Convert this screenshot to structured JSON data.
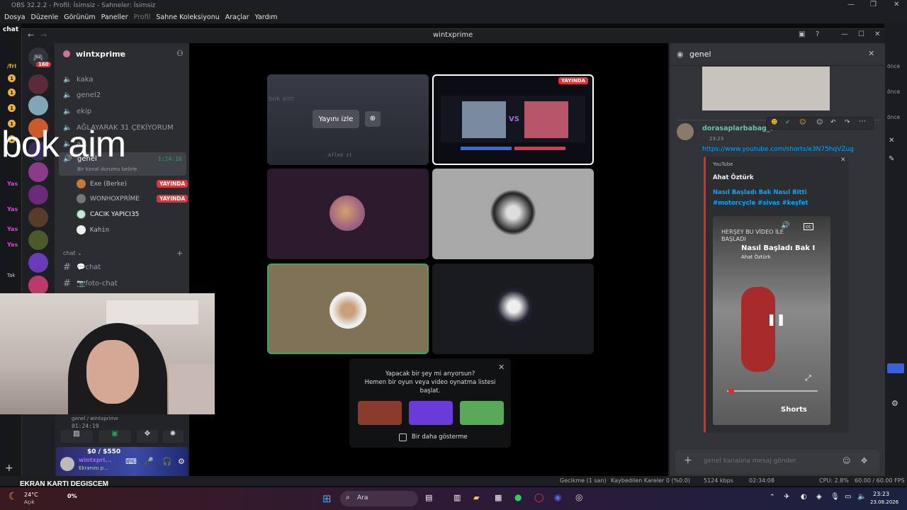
{
  "obs": {
    "title": "OBS 32.2.2 - Profil: İsimsiz - Sahneler: İsimsiz",
    "menu": [
      "Dosya",
      "Düzenle",
      "Görünüm",
      "Paneller",
      "Profil",
      "Sahne Koleksiyonu",
      "Araçlar",
      "Yardım"
    ],
    "left_dock_title": "chat",
    "left_dock_items": [
      "/fri",
      "Yas",
      "Yas",
      "Yas",
      "Yas",
      "Tak"
    ],
    "right_dock_items": [
      "önce",
      "önce",
      "önce"
    ],
    "status": {
      "delay": "Gecikme (1 san)",
      "dropped": "Kaybedilen Kareler 0 (%0.0)",
      "bitrate": "5124 kbps",
      "time": "02:34:08",
      "cpu": "CPU: 2.8%",
      "fps": "60.00 / 60.00 FPS"
    }
  },
  "discord": {
    "window_title": "wintxprime",
    "guild_badge": "160",
    "server_name": "wintxprime",
    "voice_channels": [
      "kaka",
      "genel2",
      "ekip",
      "AĞLAYARAK 31 ÇEKİYORUM",
      "a..."
    ],
    "active_channel": {
      "name": "genel",
      "timer": "1:24:18",
      "status_hint": "Bir kanal durumu belirle"
    },
    "voice_users": [
      {
        "name": "Exe (Berke)",
        "live": "YAYINDA"
      },
      {
        "name": "WONHOXPRİME",
        "live": "YAYINDA"
      },
      {
        "name": "CACIK YAPICI35",
        "live": ""
      },
      {
        "name": "Kahin",
        "live": ""
      }
    ],
    "text_category": "chat",
    "text_channels": [
      "💬chat",
      "📷foto-chat"
    ],
    "voice_panel": {
      "channel": "genel / wintxprime",
      "time": "01:24:19",
      "user": "wintxpri...",
      "user_status": "Ekranını p...",
      "overlay_money": "$0 / $550"
    },
    "stage": {
      "watch_button": "Yayını izle",
      "live_badge": "YAYINDA",
      "tile_texts": [
        "bok aim",
        "Afled it"
      ],
      "suggestion": {
        "line1": "Yapacak bir şey mi arıyorsun?",
        "line2": "Hemen bir oyun veya video oynatma listesi",
        "line3": "başlat.",
        "checkbox_label": "Bir daha gösterme"
      }
    },
    "chat_panel": {
      "title": "genel",
      "author": "dorasaplarbabag_7",
      "time": "23:23",
      "link": "https://www.youtube.com/shorts/e3N75hqVZug",
      "embed_provider": "YouTube",
      "embed_author": "Ahat Öztürk",
      "embed_title": "Nasıl Başladı Bak Nasıl Bitti #motorcycle #sivas #keşfet",
      "video_overlay_top": "HERŞEY BU VİDEO İLE BAŞLADI",
      "video_title": "Nasıl Başladı Bak I",
      "video_channel": "Ahat Öztürk",
      "shorts_label": "Shorts",
      "input_placeholder": "genel kanalına mesaj gönder"
    }
  },
  "overlays": {
    "bok_aim": "bok aim",
    "ekran": "EKRAN KARTI DEGISCEM"
  },
  "taskbar": {
    "weather_temp": "24°C",
    "weather_desc": "Açık",
    "percent": "0%",
    "search": "Ara",
    "clock_time": "23:23",
    "clock_date": "23.08.2026"
  }
}
